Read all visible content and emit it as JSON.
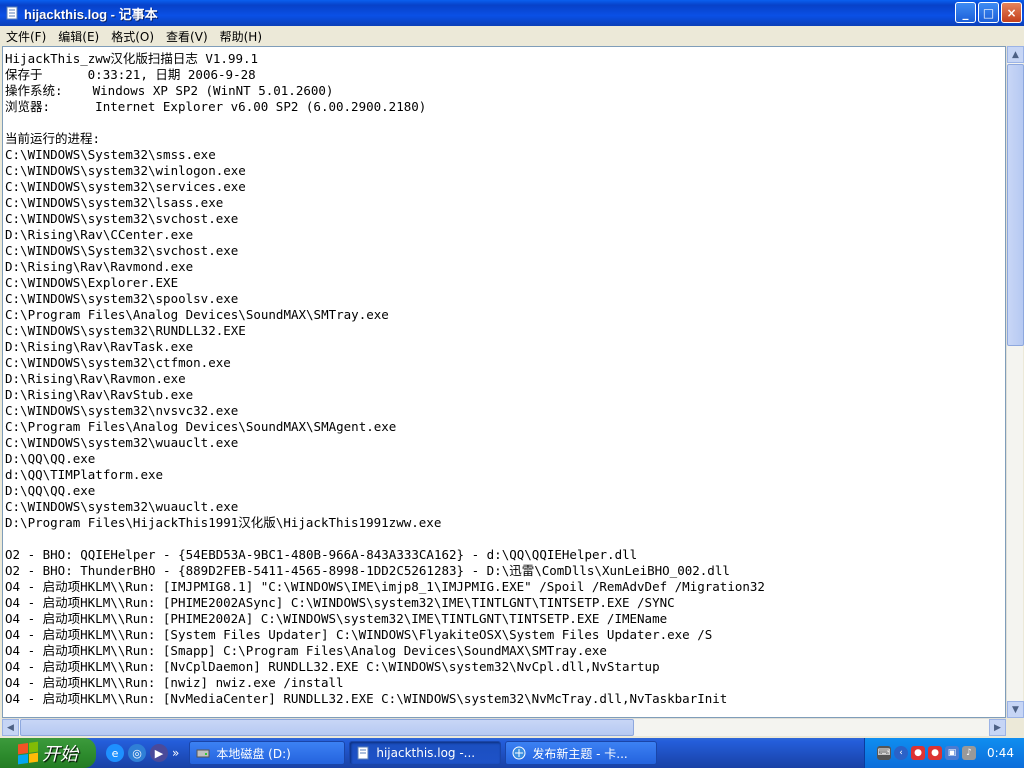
{
  "window": {
    "title": "hijackthis.log - 记事本",
    "minimize_label": "_",
    "maximize_label": "□",
    "close_label": "×"
  },
  "menu": {
    "file": "文件(F)",
    "edit": "编辑(E)",
    "format": "格式(O)",
    "view": "查看(V)",
    "help": "帮助(H)"
  },
  "content": {
    "lines": [
      "HijackThis_zww汉化版扫描日志 V1.99.1",
      "保存于      0:33:21, 日期 2006-9-28",
      "操作系统:    Windows XP SP2 (WinNT 5.01.2600)",
      "浏览器:      Internet Explorer v6.00 SP2 (6.00.2900.2180)",
      "",
      "当前运行的进程:",
      "C:\\WINDOWS\\System32\\smss.exe",
      "C:\\WINDOWS\\system32\\winlogon.exe",
      "C:\\WINDOWS\\system32\\services.exe",
      "C:\\WINDOWS\\system32\\lsass.exe",
      "C:\\WINDOWS\\system32\\svchost.exe",
      "D:\\Rising\\Rav\\CCenter.exe",
      "C:\\WINDOWS\\System32\\svchost.exe",
      "D:\\Rising\\Rav\\Ravmond.exe",
      "C:\\WINDOWS\\Explorer.EXE",
      "C:\\WINDOWS\\system32\\spoolsv.exe",
      "C:\\Program Files\\Analog Devices\\SoundMAX\\SMTray.exe",
      "C:\\WINDOWS\\system32\\RUNDLL32.EXE",
      "D:\\Rising\\Rav\\RavTask.exe",
      "C:\\WINDOWS\\system32\\ctfmon.exe",
      "D:\\Rising\\Rav\\Ravmon.exe",
      "D:\\Rising\\Rav\\RavStub.exe",
      "C:\\WINDOWS\\system32\\nvsvc32.exe",
      "C:\\Program Files\\Analog Devices\\SoundMAX\\SMAgent.exe",
      "C:\\WINDOWS\\system32\\wuauclt.exe",
      "D:\\QQ\\QQ.exe",
      "d:\\QQ\\TIMPlatform.exe",
      "D:\\QQ\\QQ.exe",
      "C:\\WINDOWS\\system32\\wuauclt.exe",
      "D:\\Program Files\\HijackThis1991汉化版\\HijackThis1991zww.exe",
      "",
      "O2 - BHO: QQIEHelper - {54EBD53A-9BC1-480B-966A-843A333CA162} - d:\\QQ\\QQIEHelper.dll",
      "O2 - BHO: ThunderBHO - {889D2FEB-5411-4565-8998-1DD2C5261283} - D:\\迅雷\\ComDlls\\XunLeiBHO_002.dll",
      "O4 - 启动项HKLM\\\\Run: [IMJPMIG8.1] \"C:\\WINDOWS\\IME\\imjp8_1\\IMJPMIG.EXE\" /Spoil /RemAdvDef /Migration32",
      "O4 - 启动项HKLM\\\\Run: [PHIME2002ASync] C:\\WINDOWS\\system32\\IME\\TINTLGNT\\TINTSETP.EXE /SYNC",
      "O4 - 启动项HKLM\\\\Run: [PHIME2002A] C:\\WINDOWS\\system32\\IME\\TINTLGNT\\TINTSETP.EXE /IMEName",
      "O4 - 启动项HKLM\\\\Run: [System Files Updater] C:\\WINDOWS\\FlyakiteOSX\\System Files Updater.exe /S",
      "O4 - 启动项HKLM\\\\Run: [Smapp] C:\\Program Files\\Analog Devices\\SoundMAX\\SMTray.exe",
      "O4 - 启动项HKLM\\\\Run: [NvCplDaemon] RUNDLL32.EXE C:\\WINDOWS\\system32\\NvCpl.dll,NvStartup",
      "O4 - 启动项HKLM\\\\Run: [nwiz] nwiz.exe /install",
      "O4 - 启动项HKLM\\\\Run: [NvMediaCenter] RUNDLL32.EXE C:\\WINDOWS\\system32\\NvMcTray.dll,NvTaskbarInit"
    ]
  },
  "taskbar": {
    "start_label": "开始",
    "tasks": [
      {
        "label": "本地磁盘 (D:)",
        "icon": "drive-icon"
      },
      {
        "label": "hijackthis.log -...",
        "icon": "notepad-icon",
        "active": true
      },
      {
        "label": "发布新主题 - 卡...",
        "icon": "browser-icon"
      }
    ],
    "clock": "0:44"
  }
}
